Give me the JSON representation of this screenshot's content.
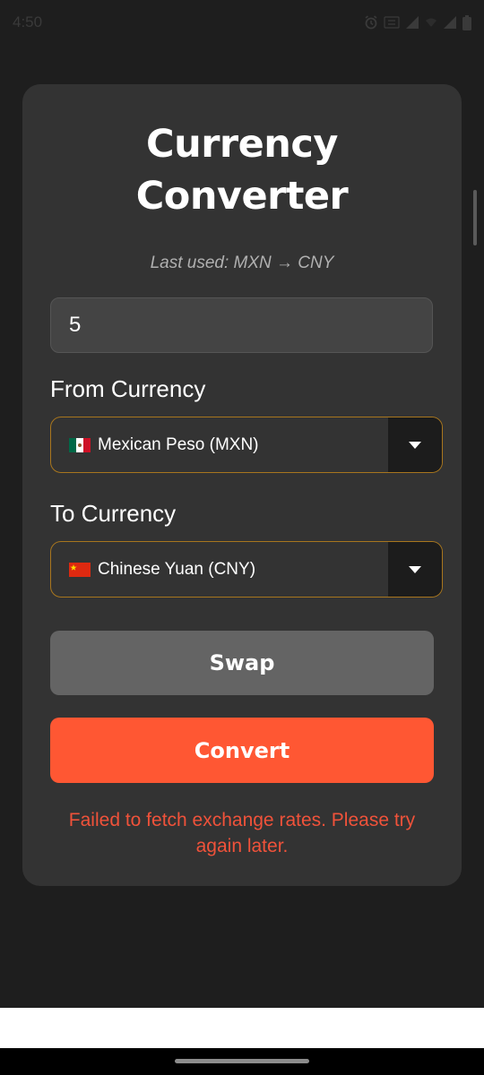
{
  "status_bar": {
    "time": "4:50",
    "icons": [
      "alarm-icon",
      "data-icon",
      "signal-icon",
      "wifi-icon",
      "signal-icon",
      "battery-icon"
    ]
  },
  "converter": {
    "title_line1": "Currency",
    "title_line2": "Converter",
    "last_used": "Last used: MXN → CNY",
    "amount_value": "5",
    "from_label": "From Currency",
    "from_value": "Mexican Peso (MXN)",
    "to_label": "To Currency",
    "to_value": "Chinese Yuan (CNY)",
    "swap_label": "Swap",
    "convert_label": "Convert",
    "error_message": "Failed to fetch exchange rates. Please try again later."
  },
  "colors": {
    "background": "#1e1e1e",
    "card": "#333333",
    "accent": "#ff5733",
    "error": "#f0523a",
    "select_border": "#a8761e"
  }
}
